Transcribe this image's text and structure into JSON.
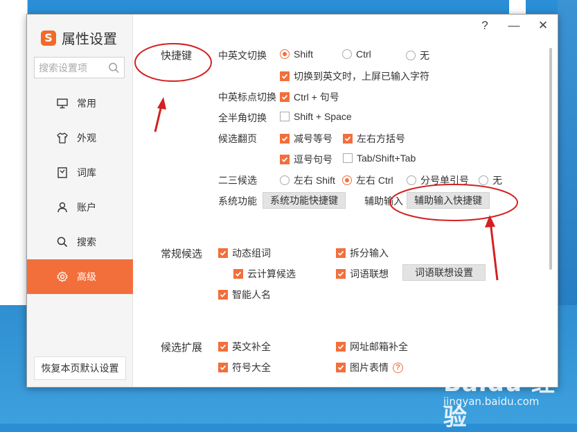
{
  "app": {
    "title": "属性设置",
    "logo_letter": "S",
    "accent_color": "#f26f3b"
  },
  "window_controls": {
    "help": "?",
    "minimize": "—",
    "close": "✕"
  },
  "sidebar": {
    "search_placeholder": "搜索设置项",
    "items": [
      {
        "label": "常用",
        "icon": "monitor-icon",
        "active": false
      },
      {
        "label": "外观",
        "icon": "shirt-icon",
        "active": false
      },
      {
        "label": "词库",
        "icon": "book-icon",
        "active": false
      },
      {
        "label": "账户",
        "icon": "user-icon",
        "active": false
      },
      {
        "label": "搜索",
        "icon": "search-icon",
        "active": false
      },
      {
        "label": "高级",
        "icon": "gear-icon",
        "active": true
      }
    ],
    "restore_button": "恢复本页默认设置"
  },
  "shortcuts": {
    "section_title": "快捷键",
    "cn_en_switch": {
      "label": "中英文切换",
      "options": [
        "Shift",
        "Ctrl",
        "无"
      ],
      "selected": "Shift",
      "commit_checkbox": {
        "label": "切换到英文时，上屏已输入字符",
        "checked": true
      }
    },
    "punct_switch": {
      "label": "中英标点切换",
      "option": {
        "label": "Ctrl + 句号",
        "checked": true
      }
    },
    "half_full": {
      "label": "全半角切换",
      "option": {
        "label": "Shift + Space",
        "checked": false
      }
    },
    "paging": {
      "label": "候选翻页",
      "options": [
        {
          "label": "减号等号",
          "checked": true
        },
        {
          "label": "左右方括号",
          "checked": true
        },
        {
          "label": "逗号句号",
          "checked": true
        },
        {
          "label": "Tab/Shift+Tab",
          "checked": false
        }
      ]
    },
    "second_third": {
      "label": "二三候选",
      "options": [
        "左右 Shift",
        "左右 Ctrl",
        "分号单引号",
        "无"
      ],
      "selected": "左右 Ctrl"
    },
    "system_function": {
      "label": "系统功能",
      "button": "系统功能快捷键"
    },
    "aux_input": {
      "label": "辅助输入",
      "button": "辅助输入快捷键"
    }
  },
  "general_candidates": {
    "section_title": "常规候选",
    "options": [
      {
        "label": "动态组词",
        "checked": true
      },
      {
        "label": "拆分输入",
        "checked": true
      },
      {
        "label": "云计算候选",
        "checked": true
      },
      {
        "label": "词语联想",
        "checked": true
      },
      {
        "label": "智能人名",
        "checked": true
      }
    ],
    "assoc_button": "词语联想设置"
  },
  "candidate_ext": {
    "section_title": "候选扩展",
    "options": [
      {
        "label": "英文补全",
        "checked": true
      },
      {
        "label": "网址邮箱补全",
        "checked": true
      },
      {
        "label": "符号大全",
        "checked": true
      },
      {
        "label": "图片表情",
        "checked": true
      }
    ]
  },
  "watermark": {
    "brand": "Baidu 经验",
    "url": "jingyan.baidu.com"
  },
  "colors": {
    "annotation_red": "#d42020",
    "active_nav": "#f26f3b",
    "desktop_blue": "#2a8fd6"
  }
}
